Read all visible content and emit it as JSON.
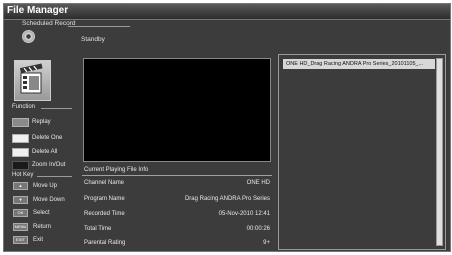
{
  "app": {
    "title": "File Manager"
  },
  "scheduled": {
    "title": "Scheduled Record",
    "status": "Standby"
  },
  "function": {
    "label": "Function",
    "items": [
      {
        "label": "Replay"
      },
      {
        "label": "Delete One"
      },
      {
        "label": "Delete All"
      },
      {
        "label": "Zoom In/Out"
      }
    ]
  },
  "hotkey": {
    "label": "Hot Key",
    "items": [
      {
        "key": "▲",
        "label": "Move Up"
      },
      {
        "key": "▼",
        "label": "Move Down"
      },
      {
        "key": "OK",
        "label": "Select"
      },
      {
        "key": "MENU",
        "label": "Return"
      },
      {
        "key": "EXIT",
        "label": "Exit"
      }
    ]
  },
  "info": {
    "title": "Current Playing File Info",
    "rows": [
      {
        "key": "Channel Name",
        "value": "ONE HD"
      },
      {
        "key": "Program Name",
        "value": "Drag Racing ANDRA Pro Series"
      },
      {
        "key": "Recorded Time",
        "value": "05-Nov-2010 12:41"
      },
      {
        "key": "Total Time",
        "value": "00:00:26"
      },
      {
        "key": "Parental Rating",
        "value": "9+"
      }
    ]
  },
  "files": [
    {
      "name": "ONE HD_Drag Racing ANDRA Pro Series_20101105_..."
    }
  ]
}
